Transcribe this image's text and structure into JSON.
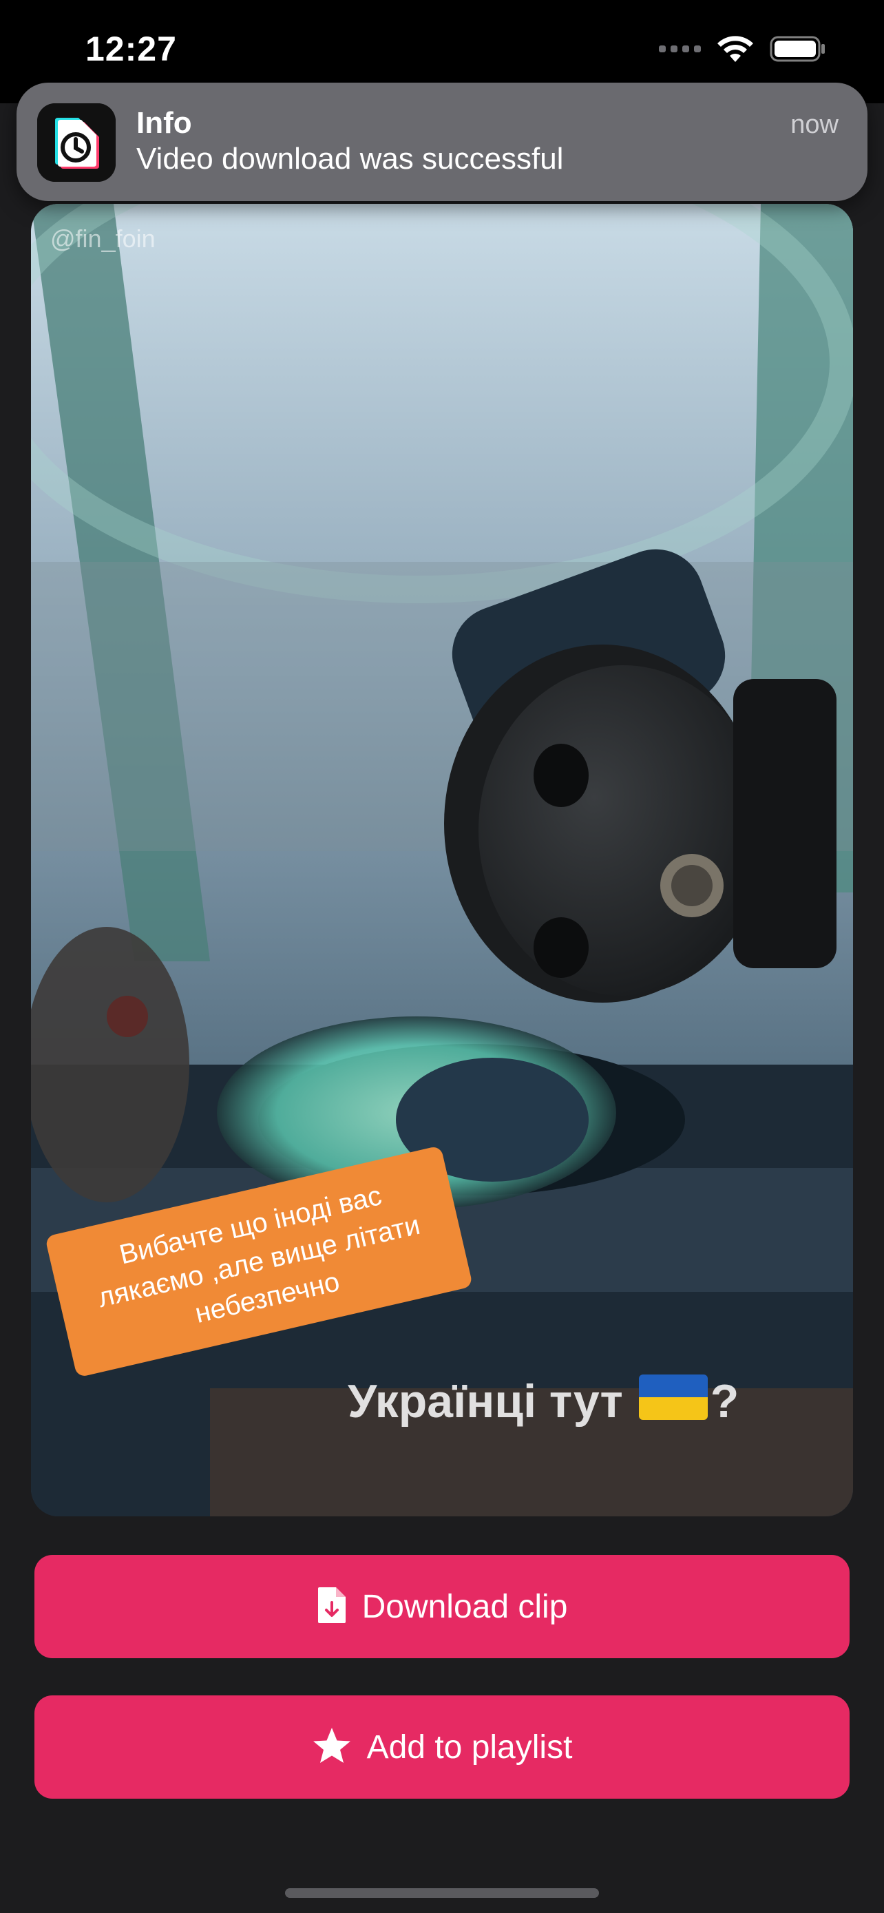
{
  "status_bar": {
    "time": "12:27",
    "icons": [
      "cellular-signal-icon",
      "wifi-icon",
      "battery-icon"
    ]
  },
  "notification": {
    "app_icon": "app-logo-icon",
    "title": "Info",
    "message": "Video download was successful",
    "time": "now"
  },
  "video": {
    "watermark": "@fin_foin",
    "caption_sticker": "Вибачте що іноді вас лякаємо ,але вище літати небезпечно",
    "overlay_text": "Українці тут",
    "overlay_suffix": "?",
    "flag_icon": "ukraine-flag-icon"
  },
  "actions": {
    "download": {
      "label": "Download clip",
      "icon": "file-download-icon"
    },
    "playlist": {
      "label": "Add to playlist",
      "icon": "star-icon"
    }
  },
  "colors": {
    "accent": "#e62a63",
    "background": "#1c1c1e",
    "notification_bg": "#6a6a6f",
    "sticker": "#f08a36",
    "flag_blue": "#1f5fbf",
    "flag_yellow": "#f5c518"
  }
}
